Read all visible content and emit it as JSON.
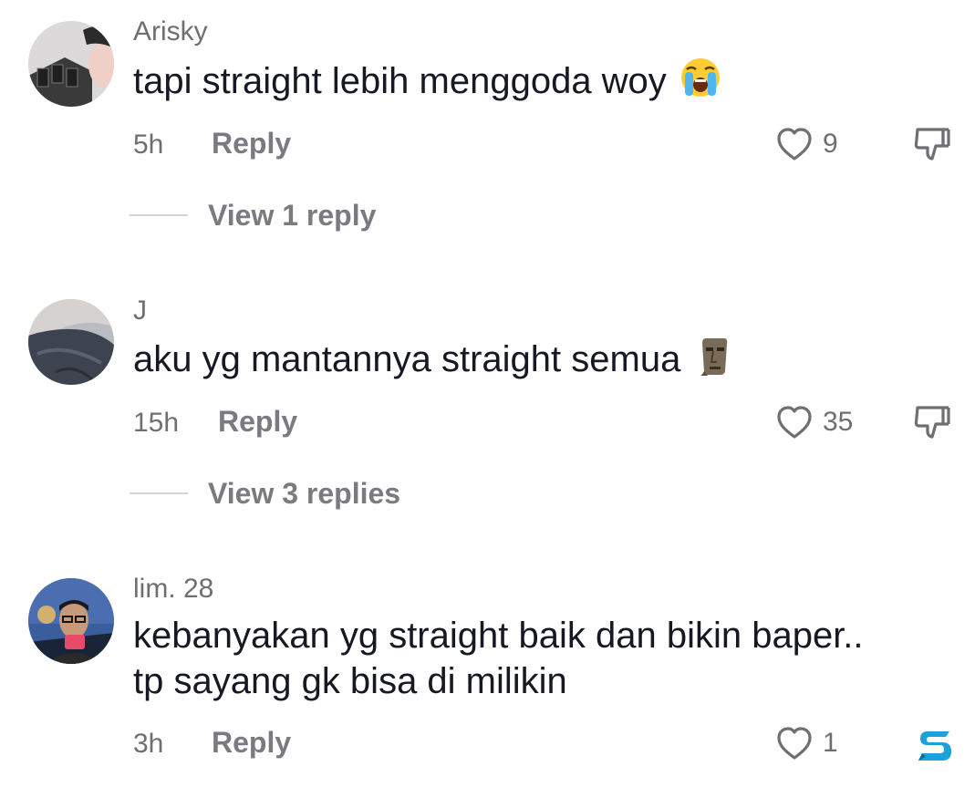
{
  "comments": [
    {
      "username": "Arisky",
      "text": "tapi straight lebih menggoda woy",
      "emoji": "loudly-crying-face-emoji",
      "time": "5h",
      "reply_label": "Reply",
      "likes": "9",
      "view_replies": "View 1 reply"
    },
    {
      "username": "J",
      "text": "aku yg mantannya straight semua",
      "emoji": "moai-emoji",
      "time": "15h",
      "reply_label": "Reply",
      "likes": "35",
      "view_replies": "View 3 replies"
    },
    {
      "username": "lim. 28",
      "text_line1": "kebanyakan yg straight baik dan bikin baper..",
      "text_line2": "tp sayang gk bisa di milikin",
      "time": "3h",
      "reply_label": "Reply",
      "likes": "1"
    }
  ],
  "icons": {
    "like": "heart-outline-icon",
    "dislike": "thumbs-down-outline-icon",
    "watermark": "stylized-s-logo"
  },
  "colors": {
    "text_primary": "#161823",
    "text_secondary": "#6e6e73",
    "watermark": "#1da1d9"
  }
}
